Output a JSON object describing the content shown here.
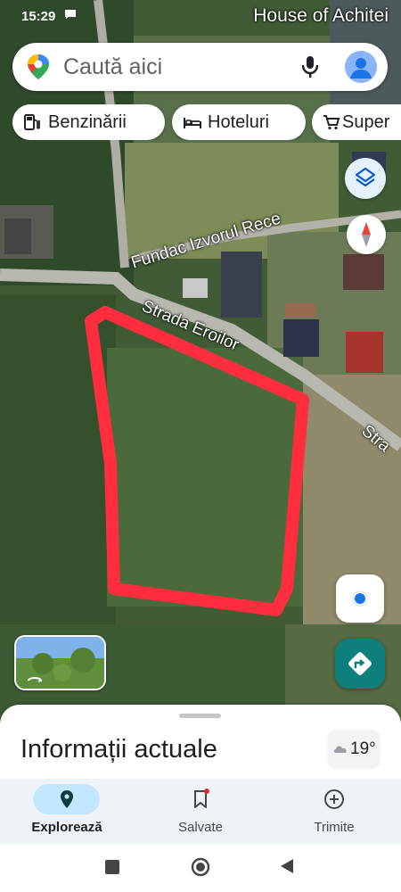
{
  "status_bar": {
    "time": "15:29",
    "place_label": "House of Achitei"
  },
  "search": {
    "placeholder": "Caută aici"
  },
  "chips": [
    {
      "label": "Benzinării",
      "icon": "gas-station-icon"
    },
    {
      "label": "Hoteluri",
      "icon": "bed-icon"
    },
    {
      "label": "Super",
      "icon": "shopping-cart-icon"
    }
  ],
  "map": {
    "labels": {
      "street_1": "Fundac Izvorul Rece",
      "street_2": "Strada Eroilor",
      "street_2_short": "Stra"
    },
    "colors": {
      "highlight_outline": "#ff2d3d"
    },
    "compass_icon": "compass-icon",
    "layers_icon": "layers-icon"
  },
  "sheet": {
    "title": "Informații actuale",
    "weather": {
      "temperature": "19°",
      "icon": "cloud-icon"
    }
  },
  "bottom_nav": {
    "items": [
      {
        "label": "Explorează",
        "icon": "location-pin-icon",
        "active": true
      },
      {
        "label": "Salvate",
        "icon": "bookmark-icon",
        "active": false
      },
      {
        "label": "Trimite",
        "icon": "add-circle-icon",
        "active": false
      }
    ]
  },
  "colors": {
    "accent": "#0f7f7c",
    "active_pill": "#c2e7ff",
    "nav_bg": "#eef3f8"
  }
}
